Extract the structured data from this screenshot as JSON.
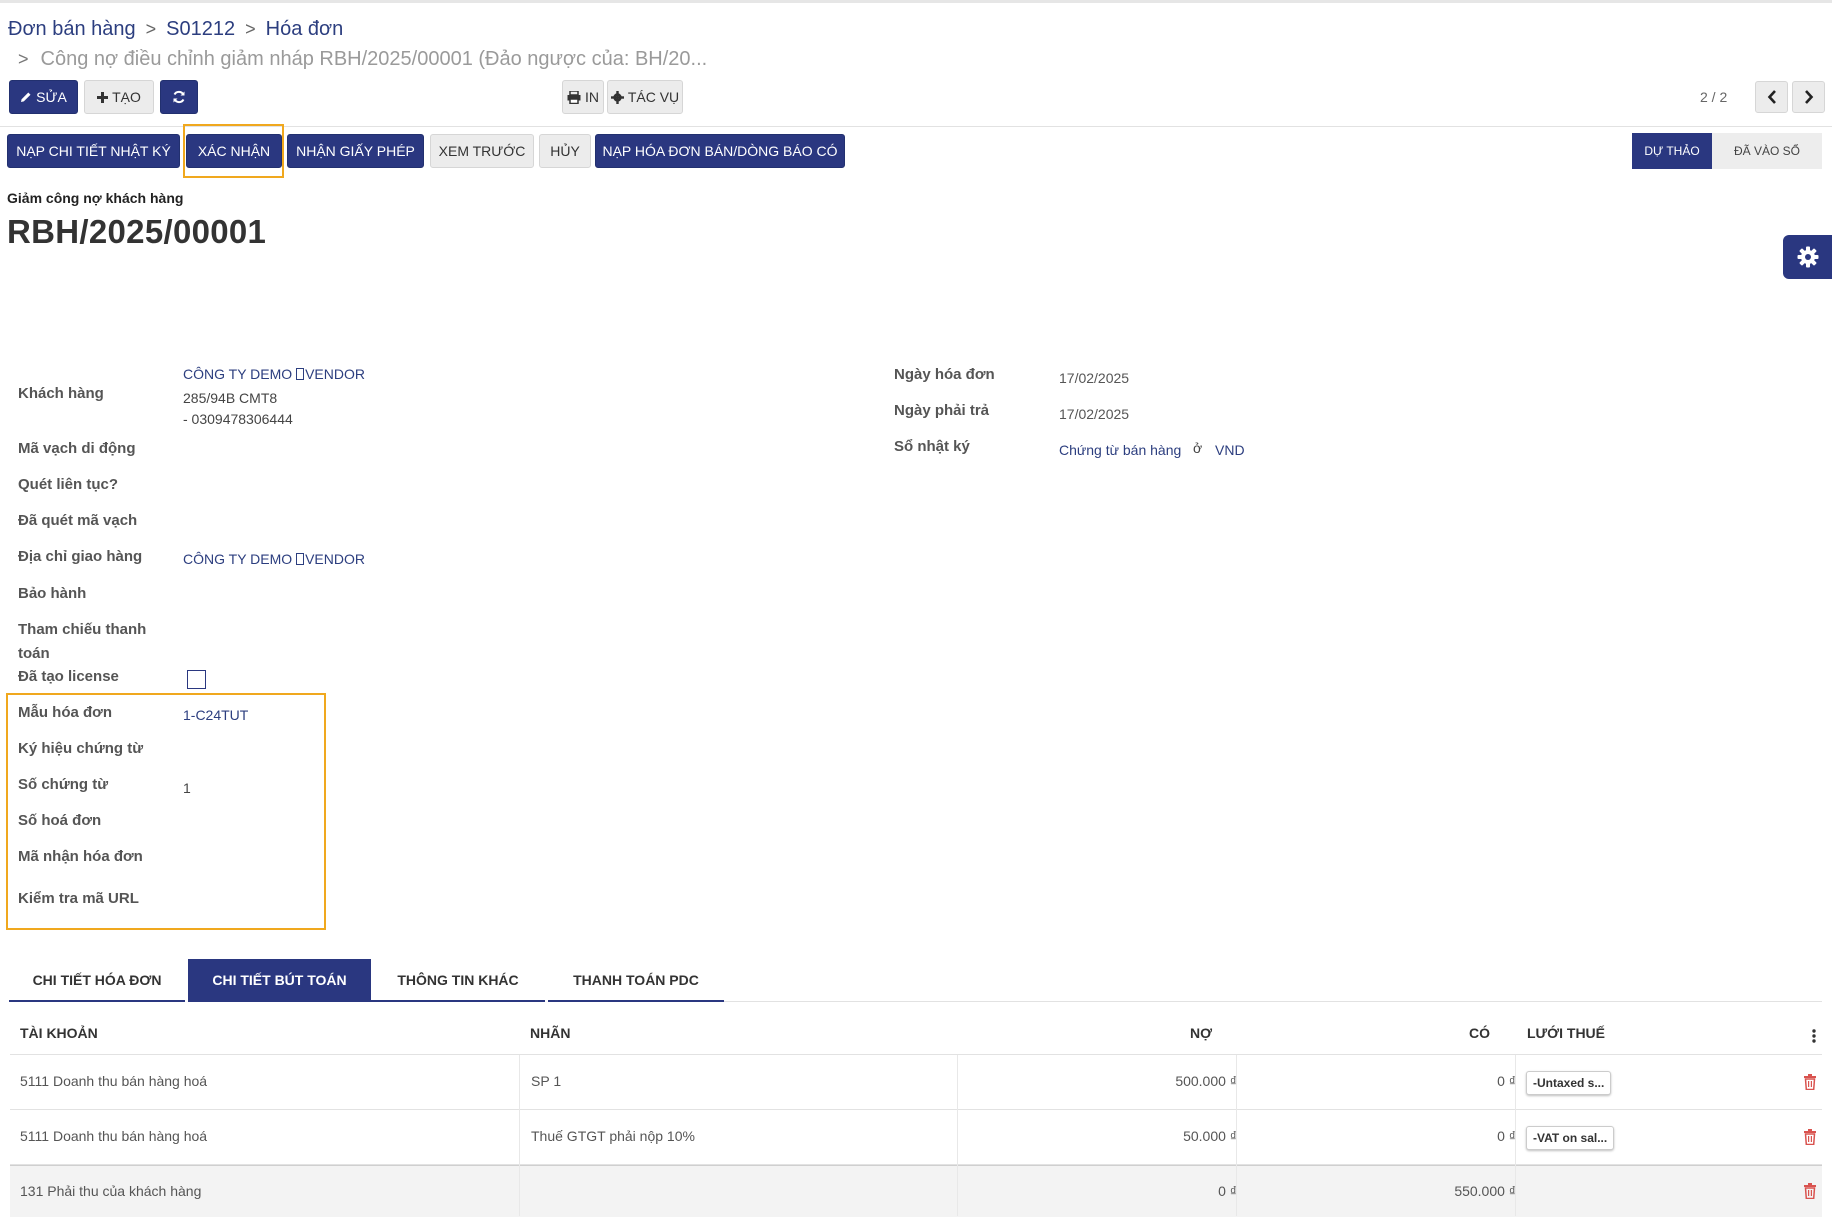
{
  "breadcrumb": {
    "items": [
      "Đơn bán hàng",
      "S01212",
      "Hóa đơn"
    ],
    "current": "Công nợ điều chỉnh giảm nháp RBH/2025/00001 (Đảo ngược của: BH/20..."
  },
  "toolbar": {
    "edit_label": "SỬA",
    "create_label": "TẠO",
    "print_label": "IN",
    "action_label": "TÁC VỤ",
    "pager": "2 / 2"
  },
  "action_buttons": {
    "journal_detail": "NẠP CHI TIẾT NHẬT KÝ",
    "confirm": "XÁC NHẬN",
    "license": "NHẬN GIẤY PHÉP",
    "preview": "XEM TRƯỚC",
    "cancel": "HỦY",
    "load_invoice": "NẠP HÓA ĐƠN BÁN/DÒNG BÁO CÓ"
  },
  "status": {
    "draft": "DỰ THẢO",
    "posted": "ĐÃ VÀO SỔ"
  },
  "document": {
    "subtitle": "Giảm công nợ khách hàng",
    "title": "RBH/2025/00001"
  },
  "fields_left": {
    "customer_label": "Khách hàng",
    "customer_name": "CÔNG TY DEMO ",
    "customer_name_suffix": "VENDOR",
    "customer_addr1": "285/94B CMT8",
    "customer_addr2": "- 0309478306444",
    "mobile_barcode_label": "Mã vạch di động",
    "continuous_scan_label": "Quét liên tục?",
    "scanned_barcode_label": "Đã quét mã vạch",
    "delivery_addr_label": "Địa chỉ giao hàng",
    "delivery_addr_value": "CÔNG TY DEMO ",
    "delivery_addr_suffix": "VENDOR",
    "warranty_label": "Bảo hành",
    "payment_ref_label_1": "Tham chiếu thanh",
    "payment_ref_label_2": "toán",
    "license_created_label": "Đã tạo license",
    "invoice_template_label": "Mẫu hóa đơn",
    "invoice_template_value": "1-C24TUT",
    "doc_symbol_label": "Ký hiệu chứng từ",
    "doc_number_label": "Số chứng từ",
    "doc_number_value": "1",
    "invoice_number_label": "Số hoá đơn",
    "invoice_code_label": "Mã nhận hóa đơn",
    "check_url_label": "Kiểm tra mã URL"
  },
  "fields_right": {
    "invoice_date_label": "Ngày hóa đơn",
    "invoice_date_value": "17/02/2025",
    "due_date_label": "Ngày phải trả",
    "due_date_value": "17/02/2025",
    "journal_label": "Sổ nhật ký",
    "journal_value": "Chứng từ bán hàng",
    "journal_in": "ở",
    "currency": "VND"
  },
  "tabs": [
    "CHI TIẾT HÓA ĐƠN",
    "CHI TIẾT BÚT TOÁN",
    "THÔNG TIN KHÁC",
    "THANH TOÁN PDC"
  ],
  "table": {
    "headers": {
      "account": "TÀI KHOẢN",
      "label": "NHÃN",
      "debit": "NỢ",
      "credit": "CÓ",
      "tax_grid": "LƯỚI THUẾ"
    },
    "rows": [
      {
        "account": "5111 Doanh thu bán hàng hoá",
        "label": "SP 1",
        "debit": "500.000 ₫",
        "credit": "0 ₫",
        "tax": "-Untaxed s..."
      },
      {
        "account": "5111 Doanh thu bán hàng hoá",
        "label": "Thuế GTGT phải nộp 10%",
        "debit": "50.000 ₫",
        "credit": "0 ₫",
        "tax": "-VAT on sal..."
      },
      {
        "account": "131 Phải thu của khách hàng",
        "label": "",
        "debit": "0 ₫",
        "credit": "550.000 ₫",
        "tax": ""
      }
    ]
  },
  "colors": {
    "primary": "#2a3780",
    "highlight": "#f0a81e",
    "link": "#2c3e7f",
    "danger": "#d9534f"
  }
}
